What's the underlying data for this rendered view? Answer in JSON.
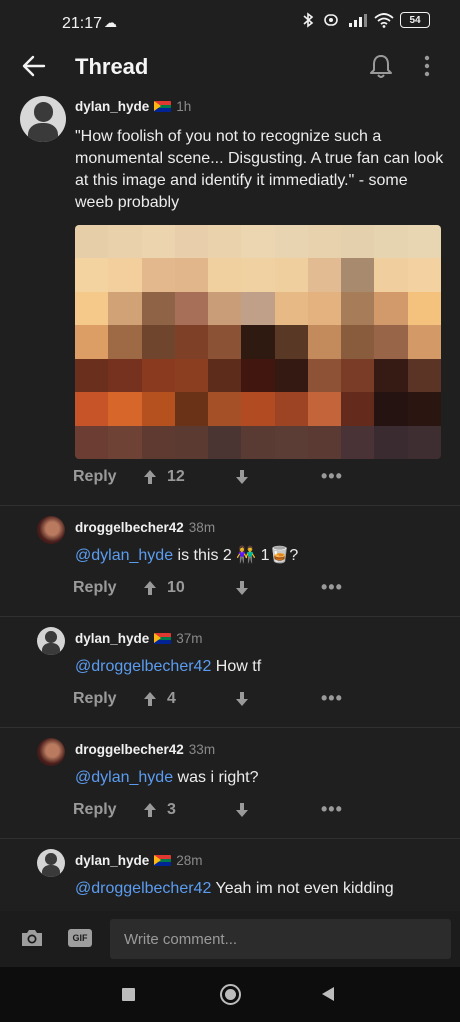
{
  "status_bar": {
    "time": "21:17",
    "battery": "54",
    "icons": [
      "cloud-icon",
      "bluetooth-icon",
      "vibrate-icon",
      "signal-icon",
      "wifi-icon",
      "battery-icon"
    ]
  },
  "header": {
    "title": "Thread",
    "icons": [
      "back-arrow-icon",
      "bell-icon",
      "kebab-menu-icon"
    ]
  },
  "actions_labels": {
    "reply": "Reply",
    "more": "•••"
  },
  "posts": [
    {
      "username": "dylan_hyde",
      "flag": "south-africa-flag",
      "time": "1h",
      "text": "\"How foolish of you not to recognize such a monumental scene... Disgusting. A true fan can look at this image and identify it immediatly.\" - some weeb probably",
      "upvotes": "12"
    },
    {
      "username": "droggelbecher42",
      "time": "38m",
      "mention": "@dylan_hyde",
      "text": " is this 2 👫 1🥃?",
      "upvotes": "10"
    },
    {
      "username": "dylan_hyde",
      "flag": "south-africa-flag",
      "time": "37m",
      "mention": "@droggelbecher42",
      "text": " How tf",
      "upvotes": "4"
    },
    {
      "username": "droggelbecher42",
      "time": "33m",
      "mention": "@dylan_hyde",
      "text": " was i right?",
      "upvotes": "3"
    },
    {
      "username": "dylan_hyde",
      "flag": "south-africa-flag",
      "time": "28m",
      "mention": "@droggelbecher42",
      "text": " Yeah im not even kidding"
    }
  ],
  "composer": {
    "placeholder": "Write comment...",
    "gif_label": "GIF"
  },
  "pixel_image_colors": [
    "#e6cfa8",
    "#e9d2ab",
    "#ebd4ae",
    "#e8ceaa",
    "#ead3ac",
    "#ebd6b1",
    "#e8d4b1",
    "#e7d2ad",
    "#e5d0ad",
    "#e6d3b0",
    "#e8d6b2",
    "#f3d3a0",
    "#f2cf9c",
    "#e4b88d",
    "#e2b68b",
    "#f1d0a0",
    "#f0d1a1",
    "#efcf9e",
    "#e2bb92",
    "#a88a6f",
    "#f1ce9e",
    "#f4d1a0",
    "#f5c98a",
    "#d0a276",
    "#8f6446",
    "#a76e58",
    "#c99d78",
    "#c0a088",
    "#e7b985",
    "#e4b27e",
    "#a77c58",
    "#d29a6b",
    "#f5c27e",
    "#dd9e66",
    "#9e6a45",
    "#70452d",
    "#7e4027",
    "#8c5235",
    "#2f1a12",
    "#5a3826",
    "#c38a5c",
    "#8a5c3e",
    "#986548",
    "#d39966",
    "#6b2f1d",
    "#76321e",
    "#8a3b1f",
    "#8c3f20",
    "#5d2c1a",
    "#41160f",
    "#341812",
    "#8e5236",
    "#7b3c27",
    "#361b14",
    "#5b3425",
    "#c75429",
    "#d7662a",
    "#b5511f",
    "#6a3318",
    "#a65028",
    "#b24b22",
    "#9d4424",
    "#c4643a",
    "#642b1c",
    "#241310",
    "#2a1510",
    "#6c3e33",
    "#6e4235",
    "#5e3a30",
    "#5a3a31",
    "#4a3532",
    "#5a3b33",
    "#5c3d35",
    "#5a3a33",
    "#4a3337",
    "#3a2b30",
    "#3f2e31"
  ]
}
